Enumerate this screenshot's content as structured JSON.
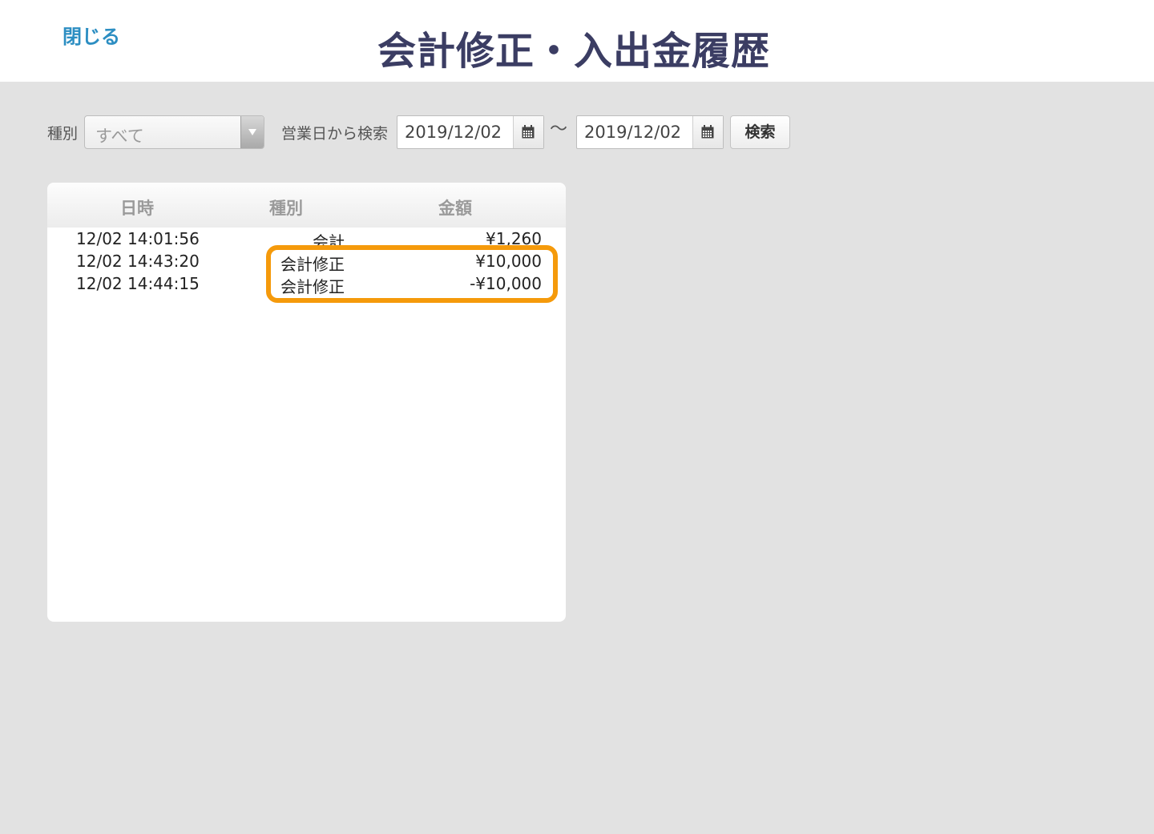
{
  "header": {
    "close_label": "閉じる",
    "title": "会計修正・入出金履歴"
  },
  "filters": {
    "type_label": "種別",
    "type_selected": "すべて",
    "date_label": "営業日から検索",
    "date_from": "2019/12/02",
    "date_to": "2019/12/02",
    "range_separator": "〜",
    "search_label": "検索"
  },
  "table": {
    "columns": [
      "日時",
      "種別",
      "金額"
    ],
    "rows": [
      {
        "datetime": "12/02 14:01:56",
        "type": "会計",
        "amount": "¥1,260"
      },
      {
        "datetime": "12/02 14:43:20",
        "type": "会計修正",
        "amount": "¥10,000"
      },
      {
        "datetime": "12/02 14:44:15",
        "type": "会計修正",
        "amount": "-¥10,000"
      }
    ]
  },
  "colors": {
    "title": "#3b3d63",
    "link": "#2c8ec2",
    "highlight": "#f59a0b",
    "background": "#e2e2e2"
  },
  "icons": [
    "chevron-down-icon",
    "calendar-icon"
  ]
}
